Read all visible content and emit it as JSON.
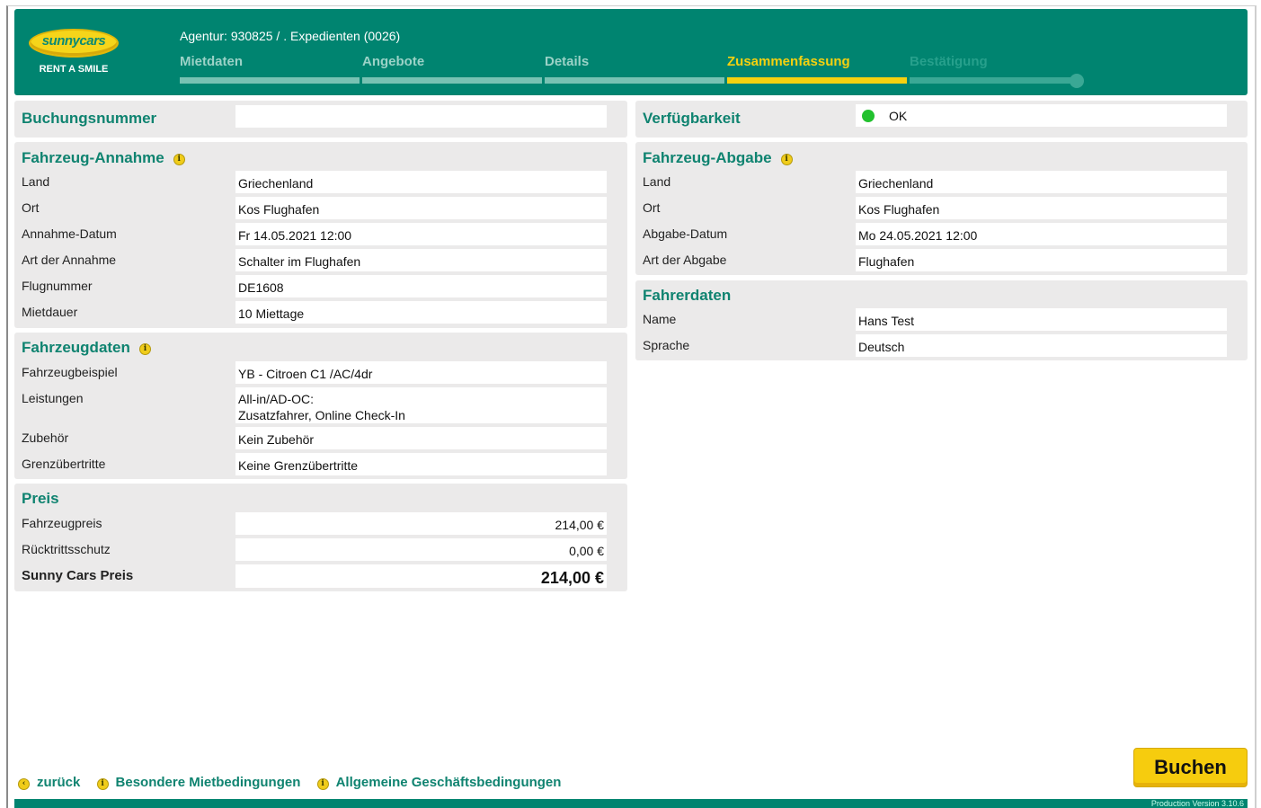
{
  "header": {
    "logo_text": "sunnycars",
    "logo_tagline": "RENT A SMILE",
    "agency": "Agentur: 930825 / . Expedienten (0026)",
    "steps": [
      {
        "label": "Mietdaten",
        "state": "done"
      },
      {
        "label": "Angebote",
        "state": "done"
      },
      {
        "label": "Details",
        "state": "done"
      },
      {
        "label": "Zusammenfassung",
        "state": "active"
      },
      {
        "label": "Bestätigung",
        "state": "future"
      }
    ]
  },
  "booking": {
    "title": "Buchungsnummer",
    "value": ""
  },
  "availability": {
    "title": "Verfügbarkeit",
    "status": "OK",
    "status_color": "#22c12e"
  },
  "pickup": {
    "title": "Fahrzeug-Annahme",
    "rows": [
      {
        "label": "Land",
        "value": "Griechenland"
      },
      {
        "label": "Ort",
        "value": "Kos Flughafen"
      },
      {
        "label": "Annahme-Datum",
        "value": "Fr 14.05.2021 12:00"
      },
      {
        "label": "Art der Annahme",
        "value": "Schalter im Flughafen"
      },
      {
        "label": "Flugnummer",
        "value": "DE1608"
      },
      {
        "label": "Mietdauer",
        "value": "10 Miettage"
      }
    ]
  },
  "dropoff": {
    "title": "Fahrzeug-Abgabe",
    "rows": [
      {
        "label": "Land",
        "value": "Griechenland"
      },
      {
        "label": "Ort",
        "value": "Kos Flughafen"
      },
      {
        "label": "Abgabe-Datum",
        "value": "Mo 24.05.2021 12:00"
      },
      {
        "label": "Art der Abgabe",
        "value": "Flughafen"
      }
    ]
  },
  "driver": {
    "title": "Fahrerdaten",
    "rows": [
      {
        "label": "Name",
        "value": "Hans Test"
      },
      {
        "label": "Sprache",
        "value": "Deutsch"
      }
    ]
  },
  "vehicle": {
    "title": "Fahrzeugdaten",
    "rows": [
      {
        "label": "Fahrzeugbeispiel",
        "value": "YB - Citroen C1 /AC/4dr"
      },
      {
        "label": "Leistungen",
        "value": "All-in/AD-OC:",
        "value2": "Zusatzfahrer, Online Check-In"
      },
      {
        "label": "Zubehör",
        "value": "Kein Zubehör"
      },
      {
        "label": "Grenzübertritte",
        "value": "Keine Grenzübertritte"
      }
    ]
  },
  "price": {
    "title": "Preis",
    "rows": [
      {
        "label": "Fahrzeugpreis",
        "value": "214,00 €"
      },
      {
        "label": "Rücktrittsschutz",
        "value": "0,00 €"
      }
    ],
    "total_label": "Sunny Cars Preis",
    "total_value": "214,00 €"
  },
  "footer": {
    "back": "zurück",
    "special_terms": "Besondere Mietbedingungen",
    "general_terms": "Allgemeine Geschäftsbedingungen",
    "book_button": "Buchen",
    "version": "Production Version 3.10.6"
  },
  "colors": {
    "brand_green": "#008470",
    "accent_yellow": "#f6d10f",
    "panel_bg": "#ebeaea"
  }
}
